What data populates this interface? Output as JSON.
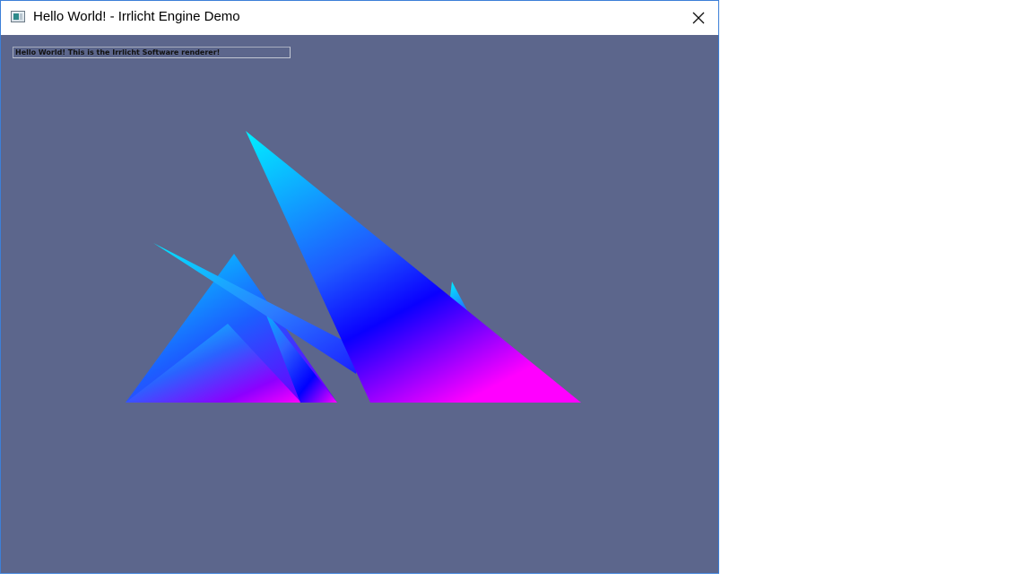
{
  "window": {
    "title": "Hello World! - Irrlicht Engine Demo",
    "icon": "app-window-icon",
    "close_icon": "close-icon"
  },
  "viewport": {
    "background_color": "#5c668c",
    "static_text": "Hello World! This is the Irrlicht Software renderer!"
  },
  "scene": {
    "gradient_colors": {
      "cyan": "#00e5ff",
      "blue": "#0a00ff",
      "magenta": "#ff00ff"
    }
  }
}
